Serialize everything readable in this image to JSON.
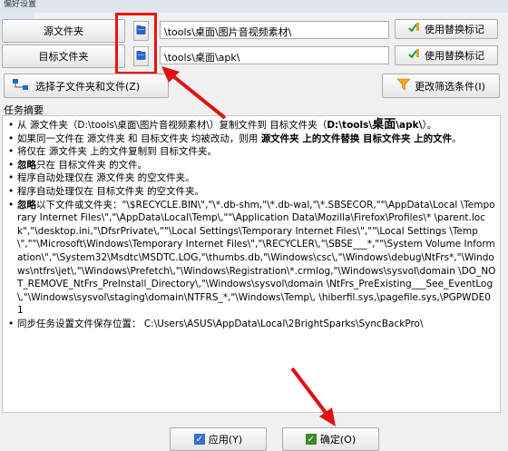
{
  "window": {
    "title": "偏好设置"
  },
  "source": {
    "label": "源文件夹",
    "path": "\\tools\\桌面\\图片音视频素材\\",
    "replace_label": "使用替换标记"
  },
  "target": {
    "label": "目标文件夹",
    "path": "\\tools\\桌面\\apk\\",
    "replace_label": "使用替换标记"
  },
  "actions": {
    "select_sub": "选择子文件夹和文件(Z)",
    "filter": "更改筛选条件(I)"
  },
  "summary": {
    "heading": "任务摘要",
    "line1_a": "从 源文件夹（D:\\tools\\桌面\\图片音视频素材\\）复制文件到 目标文件夹（",
    "line1_b": "D:\\tools\\",
    "line1_c": "桌面",
    "line1_d": "\\apk\\",
    "line1_e": "）。",
    "line2_a": "如果同一文件在 源文件夹 和 目标文件夹 均被改动，则用 ",
    "line2_b": "源文件夹 上的文件替换 目标文件夹 上的文件",
    "line2_c": "。",
    "line3": "将仅在 源文件夹 上的文件复制到 目标文件夹。",
    "line4_a": "忽略",
    "line4_b": "只在 目标文件夹 的文件。",
    "line5": "程序自动处理仅在 源文件夹 的空文件夹。",
    "line6": "程序自动处理仅在 目标文件夹 的空文件夹。",
    "line7_a": "忽略",
    "line7_b": "以下文件或文件夹：\"\\$RECYCLE.BIN\\\",\"\\*.db-shm,\"\\*.db-wal,\"\\*.SBSECOR,\"\"\\AppData\\Local \\Temporary Internet Files\\\",\"\\AppData\\Local\\Temp\\,\"\"\\Application Data\\Mozilla\\Firefox\\Profiles\\* \\parent.lock\",\"\\desktop.ini,\"\\DfsrPrivate\\,\"\"\\Local Settings\\Temporary Internet Files\\\",\"\"\\Local Settings \\Temp\\\",\"\"\\Microsoft\\Windows\\Temporary Internet Files\\\",\"\\RECYCLER\\,\"\\SBSE___*,\"\"\\System Volume Information\\\",\"\\System32\\Msdtc\\MSDTC.LOG,\"\\thumbs.db,\"\\Windows\\csc\\,\"\\Windows\\debug\\NtFrs*,\"\\Windows\\ntfrs\\jet\\,\"\\Windows\\Prefetch\\,\"\\Windows\\Registration\\*.crmlog,\"\\Windows\\sysvol\\domain \\DO_NOT_REMOVE_NtFrs_PreInstall_Directory\\,\"\\Windows\\sysvol\\domain \\NtFrs_PreExisting___See_EventLog\\,\"\\Windows\\sysvol\\staging\\domain\\NTFRS_*,\"\\Windows\\Temp\\, \\hiberfil.sys,\\pagefile.sys,\\PGPWDE01",
    "line8": "同步任务设置文件保存位置： C:\\Users\\ASUS\\AppData\\Local\\2BrightSparks\\SyncBackPro\\"
  },
  "footer": {
    "apply": "应用(Y)",
    "ok": "确定(O)"
  },
  "colors": {
    "annotation": "#e11111",
    "check_green": "#3a8b2b"
  }
}
